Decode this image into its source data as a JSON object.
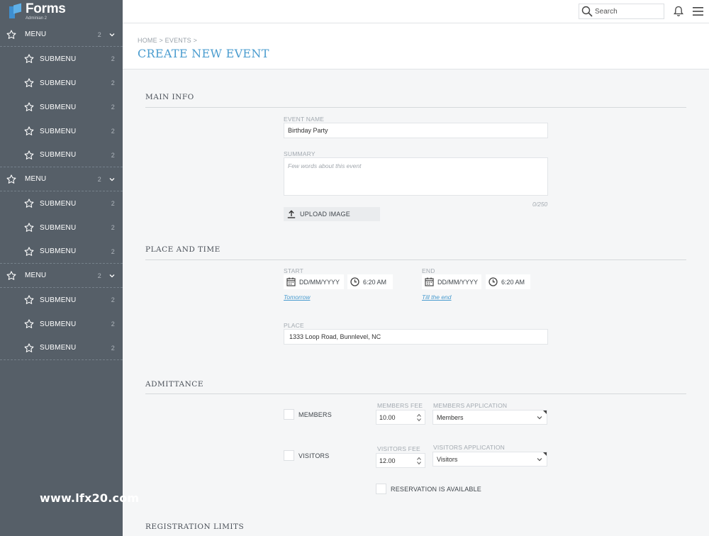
{
  "logo": {
    "title": "Forms",
    "subtitle": "Adminian 2"
  },
  "sidebar": {
    "groups": [
      {
        "label": "MENU",
        "count": "2",
        "items": [
          {
            "label": "SUBMENU",
            "count": "2"
          },
          {
            "label": "SUBMENU",
            "count": "2"
          },
          {
            "label": "SUBMENU",
            "count": "2"
          },
          {
            "label": "SUBMENU",
            "count": "2"
          },
          {
            "label": "SUBMENU",
            "count": "2"
          }
        ]
      },
      {
        "label": "MENU",
        "count": "2",
        "items": [
          {
            "label": "SUBMENU",
            "count": "2"
          },
          {
            "label": "SUBMENU",
            "count": "2"
          },
          {
            "label": "SUBMENU",
            "count": "2"
          }
        ]
      },
      {
        "label": "MENU",
        "count": "2",
        "items": [
          {
            "label": "SUBMENU",
            "count": "2"
          },
          {
            "label": "SUBMENU",
            "count": "2"
          },
          {
            "label": "SUBMENU",
            "count": "2"
          }
        ]
      }
    ]
  },
  "topbar": {
    "search_placeholder": "Search"
  },
  "header": {
    "breadcrumb": "HOME > EVENTS >",
    "title": "CREATE NEW EVENT"
  },
  "main_info": {
    "title": "MAIN INFO",
    "event_name_label": "EVENT NAME",
    "event_name_value": "Birthday Party",
    "summary_label": "SUMMARY",
    "summary_placeholder": "Few words about this event",
    "summary_counter": "0/250",
    "upload_label": "UPLOAD IMAGE"
  },
  "place_time": {
    "title": "PLACE AND TIME",
    "start_label": "START",
    "start_date": "DD/MM/YYYY",
    "start_time": "6:20 AM",
    "start_link": "Tomorrow",
    "end_label": "END",
    "end_date": "DD/MM/YYYY",
    "end_time": "6:20 AM",
    "end_link": "Till the end",
    "place_label": "PLACE",
    "place_value": "1333 Loop Road, Bunnlevel, NC"
  },
  "admittance": {
    "title": "ADMITTANCE",
    "members_label": "MEMBERS",
    "members_fee_label": "MEMBERS FEE",
    "members_fee_value": "10.00",
    "members_app_label": "MEMBERS APPLICATION",
    "members_app_value": "Members",
    "visitors_label": "VISITORS",
    "visitors_fee_label": "VISITORS FEE",
    "visitors_fee_value": "12.00",
    "visitors_app_label": "VISITORS APPLICATION",
    "visitors_app_value": "Visitors",
    "reservation_label": "RESERVATION IS AVAILABLE"
  },
  "registration": {
    "title": "REGISTRATION LIMITS"
  },
  "watermark": "www.lfx20.com"
}
